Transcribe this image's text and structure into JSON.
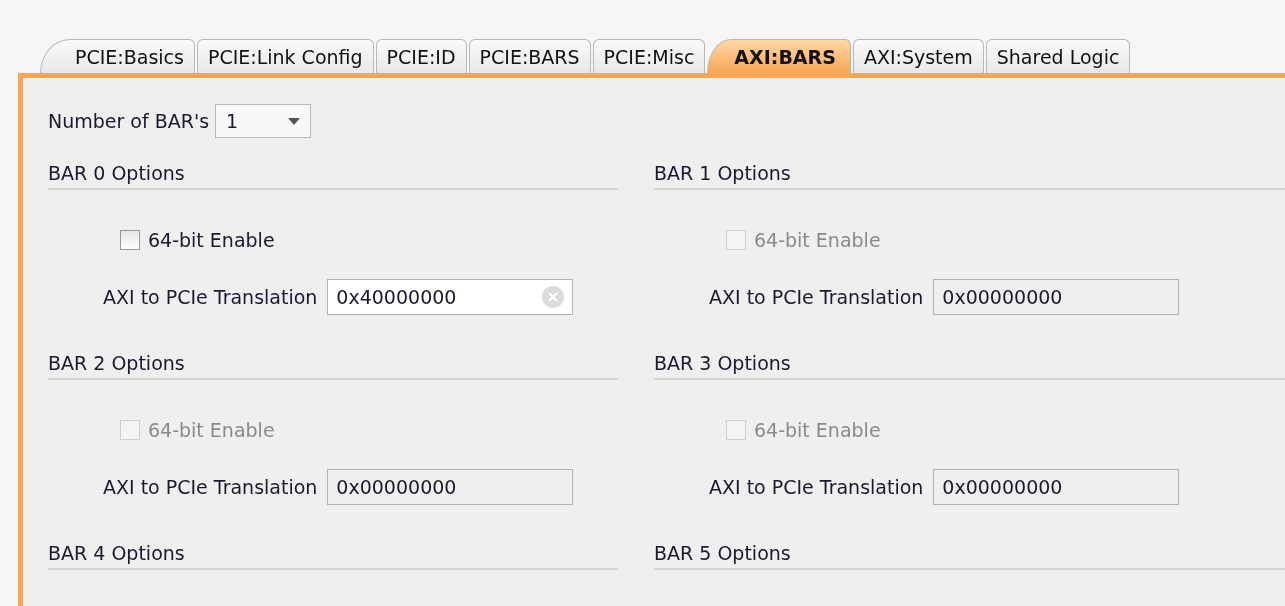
{
  "tabs": [
    {
      "label": "PCIE:Basics",
      "selected": false
    },
    {
      "label": "PCIE:Link Config",
      "selected": false
    },
    {
      "label": "PCIE:ID",
      "selected": false
    },
    {
      "label": "PCIE:BARS",
      "selected": false
    },
    {
      "label": "PCIE:Misc",
      "selected": false
    },
    {
      "label": "AXI:BARS",
      "selected": true
    },
    {
      "label": "AXI:System",
      "selected": false
    },
    {
      "label": "Shared Logic",
      "selected": false
    }
  ],
  "number_of_bars": {
    "label": "Number of BAR's",
    "value": "1"
  },
  "bars": [
    {
      "title": "BAR 0 Options",
      "enable_64bit": {
        "label": "64-bit Enable",
        "checked": false,
        "disabled": false
      },
      "translation": {
        "label": "AXI to PCIe Translation",
        "value": "0x40000000",
        "disabled": false,
        "clearable": true
      }
    },
    {
      "title": "BAR 1 Options",
      "enable_64bit": {
        "label": "64-bit Enable",
        "checked": false,
        "disabled": true
      },
      "translation": {
        "label": "AXI to PCIe Translation",
        "value": "0x00000000",
        "disabled": true,
        "clearable": false
      }
    },
    {
      "title": "BAR 2 Options",
      "enable_64bit": {
        "label": "64-bit Enable",
        "checked": false,
        "disabled": true
      },
      "translation": {
        "label": "AXI to PCIe Translation",
        "value": "0x00000000",
        "disabled": true,
        "clearable": false
      }
    },
    {
      "title": "BAR 3 Options",
      "enable_64bit": {
        "label": "64-bit Enable",
        "checked": false,
        "disabled": true
      },
      "translation": {
        "label": "AXI to PCIe Translation",
        "value": "0x00000000",
        "disabled": true,
        "clearable": false
      }
    },
    {
      "title": "BAR 4 Options"
    },
    {
      "title": "BAR 5 Options"
    }
  ]
}
